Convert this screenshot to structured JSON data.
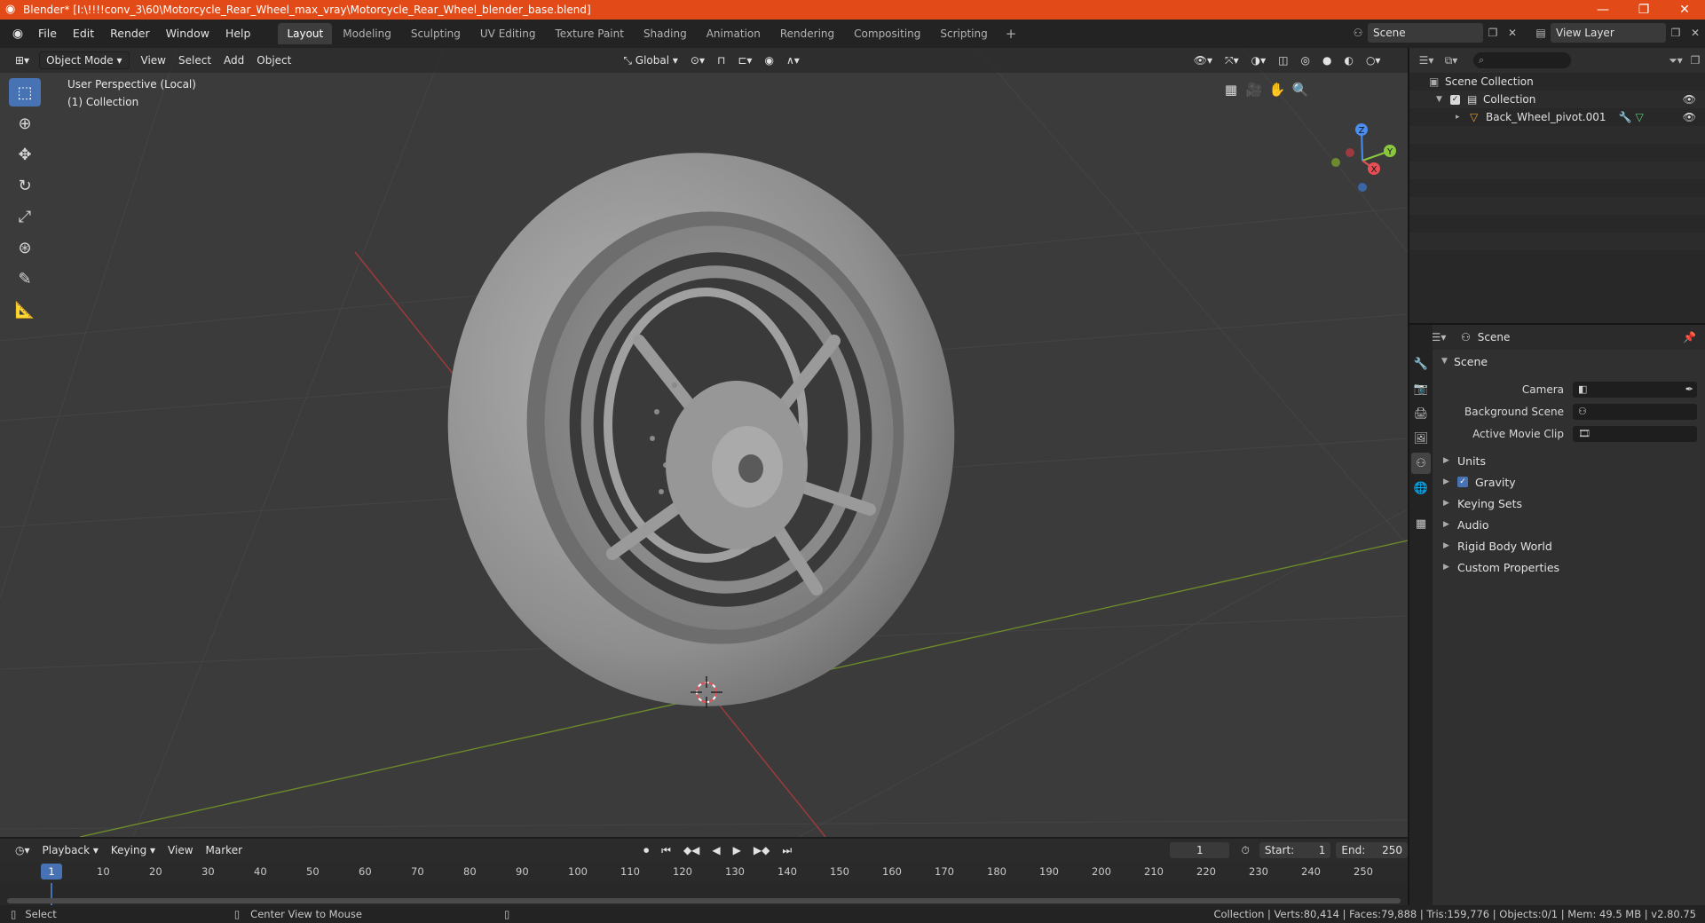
{
  "window": {
    "title": "Blender* [I:\\!!!!conv_3\\60\\Motorcycle_Rear_Wheel_max_vray\\Motorcycle_Rear_Wheel_blender_base.blend]",
    "minimize": "—",
    "maximize": "❐",
    "close": "✕"
  },
  "menubar": {
    "items": [
      "File",
      "Edit",
      "Render",
      "Window",
      "Help"
    ],
    "workspaces": [
      "Layout",
      "Modeling",
      "Sculpting",
      "UV Editing",
      "Texture Paint",
      "Shading",
      "Animation",
      "Rendering",
      "Compositing",
      "Scripting"
    ],
    "active_workspace": "Layout",
    "add_workspace": "+",
    "scene": "Scene",
    "view_layer": "View Layer"
  },
  "viewport": {
    "mode": "Object Mode",
    "menus": [
      "View",
      "Select",
      "Add",
      "Object"
    ],
    "transform_orientation": "Global",
    "perspective_label": "User Perspective (Local)",
    "collection_label": "(1) Collection",
    "gizmo": {
      "z": "Z",
      "y": "Y",
      "x": "X"
    }
  },
  "outliner": {
    "rows": [
      {
        "label": "Scene Collection",
        "icon": "scene-collection-icon"
      },
      {
        "label": "Collection",
        "icon": "collection-icon"
      },
      {
        "label": "Back_Wheel_pivot.001",
        "icon": "mesh-object-icon"
      }
    ]
  },
  "properties": {
    "header": "Scene",
    "panel": "Scene",
    "fields": [
      {
        "label": "Camera",
        "value": ""
      },
      {
        "label": "Background Scene",
        "value": ""
      },
      {
        "label": "Active Movie Clip",
        "value": ""
      }
    ],
    "subpanels": [
      "Units",
      "Gravity",
      "Keying Sets",
      "Audio",
      "Rigid Body World",
      "Custom Properties"
    ]
  },
  "timeline": {
    "menus": [
      "Playback",
      "Keying",
      "View",
      "Marker"
    ],
    "current_frame": "1",
    "start_label": "Start:",
    "start": "1",
    "end_label": "End:",
    "end": "250",
    "ruler": [
      "10",
      "20",
      "30",
      "40",
      "50",
      "60",
      "70",
      "80",
      "90",
      "100",
      "110",
      "120",
      "130",
      "140",
      "150",
      "160",
      "170",
      "180",
      "190",
      "200",
      "210",
      "220",
      "230",
      "240",
      "250"
    ]
  },
  "statusbar": {
    "select": "Select",
    "center_view": "Center View to Mouse",
    "stats": "Collection | Verts:80,414 | Faces:79,888 | Tris:159,776 | Objects:0/1 | Mem: 49.5 MB | v2.80.75"
  },
  "colors": {
    "accent": "#4772b3",
    "titlebar": "#e24a17",
    "x_axis": "#e84f55",
    "y_axis": "#8bc63f",
    "z_axis": "#4a8df0"
  }
}
